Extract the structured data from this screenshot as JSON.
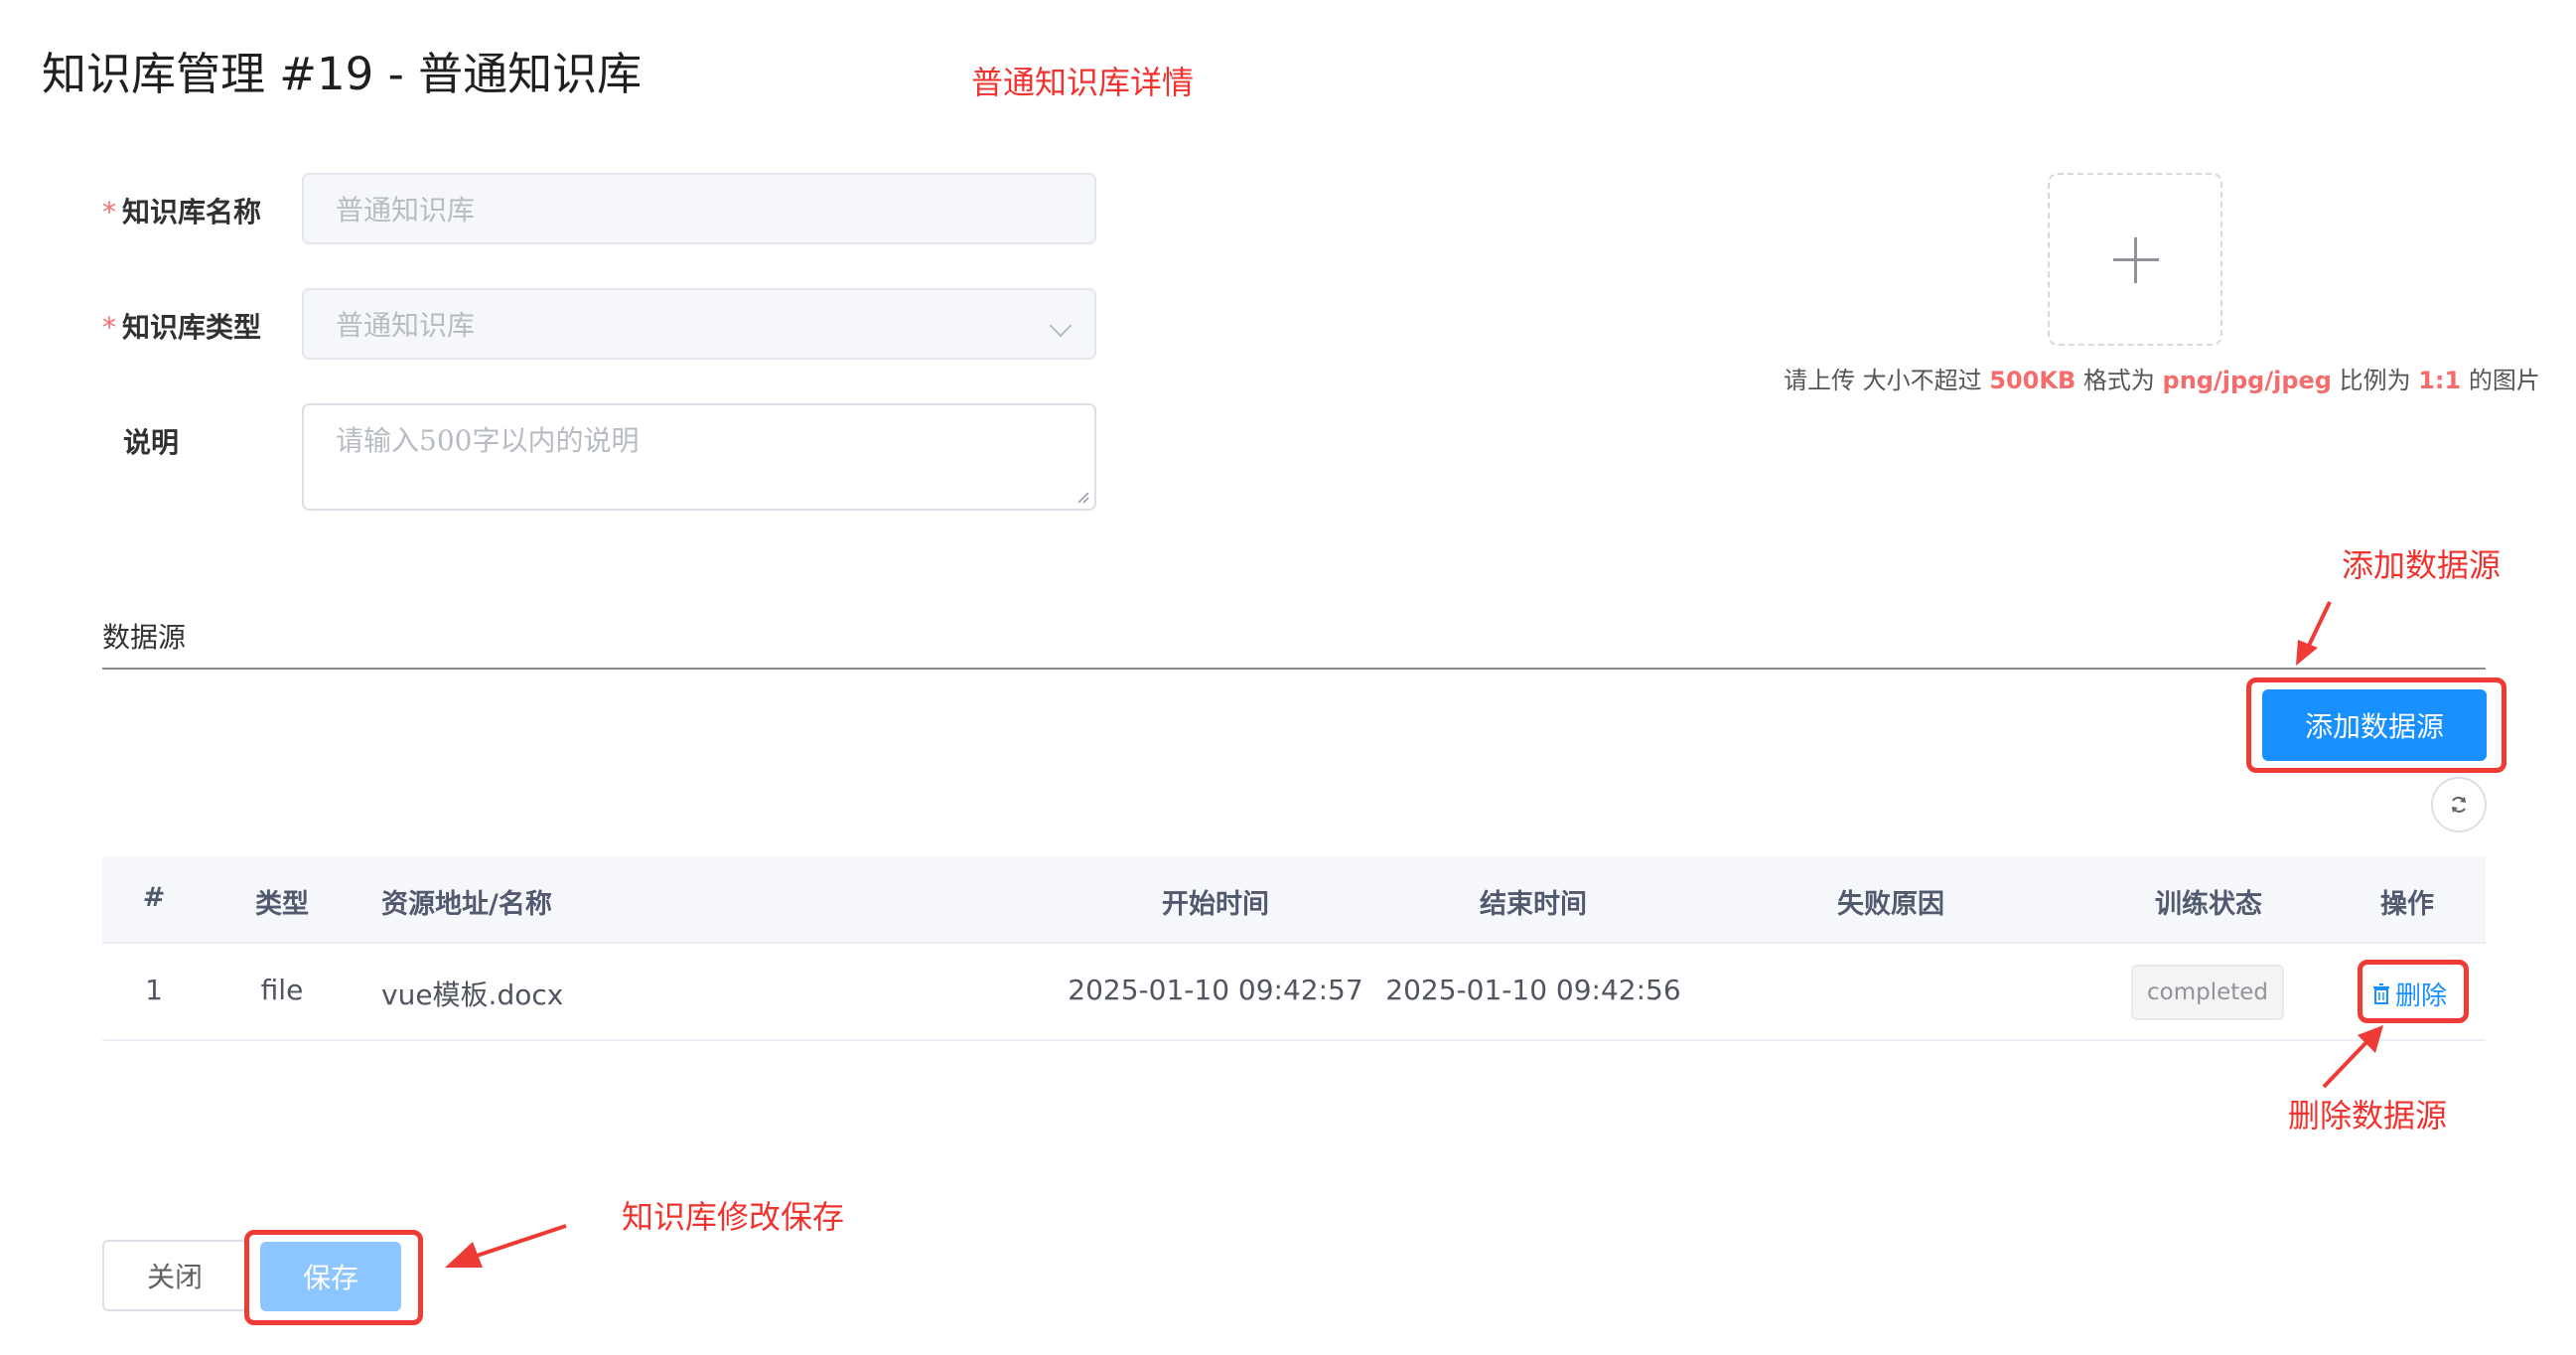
{
  "header": {
    "title": "知识库管理 #19 - 普通知识库"
  },
  "annotations": {
    "detail": "普通知识库详情",
    "add_source": "添加数据源",
    "delete_source": "删除数据源",
    "save_changes": "知识库修改保存"
  },
  "form": {
    "name_label": "知识库名称",
    "name_value": "普通知识库",
    "type_label": "知识库类型",
    "type_value": "普通知识库",
    "desc_label": "说明",
    "desc_placeholder": "请输入500字以内的说明",
    "required_mark": "*"
  },
  "upload": {
    "tip_prefix": "请上传 大小不超过 ",
    "size": "500KB",
    "tip_mid1": " 格式为 ",
    "formats": "png/jpg/jpeg",
    "tip_mid2": " 比例为 ",
    "ratio": "1:1",
    "tip_suffix": " 的图片"
  },
  "datasource": {
    "section_title": "数据源",
    "add_button": "添加数据源",
    "columns": [
      "#",
      "类型",
      "资源地址/名称",
      "开始时间",
      "结束时间",
      "失败原因",
      "训练状态",
      "操作"
    ],
    "rows": [
      {
        "index": "1",
        "type": "file",
        "name": "vue模板.docx",
        "start_time": "2025-01-10 09:42:57",
        "end_time": "2025-01-10 09:42:56",
        "fail_reason": "",
        "status": "completed",
        "action": "删除"
      }
    ]
  },
  "footer": {
    "close_button": "关闭",
    "save_button": "保存"
  },
  "colors": {
    "primary": "#1890ff",
    "annotation_red": "#ee3b35",
    "required": "#f56c6c"
  }
}
